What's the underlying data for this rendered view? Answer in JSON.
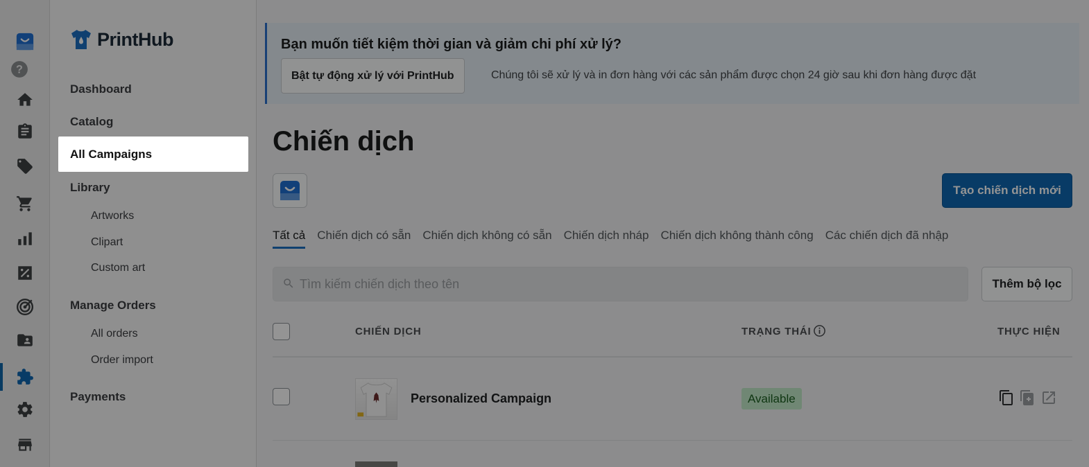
{
  "brand": {
    "name": "PrintHub"
  },
  "rail": {
    "icons": [
      "store-logo-icon",
      "help-icon",
      "home-icon",
      "orders-icon",
      "tags-icon",
      "cart-icon",
      "analytics-icon",
      "discounts-icon",
      "marketing-icon",
      "files-icon",
      "apps-icon",
      "settings-icon",
      "online-store-icon"
    ],
    "active": "apps-icon"
  },
  "nav": {
    "dashboard": "Dashboard",
    "catalog": "Catalog",
    "all_campaigns": "All Campaigns",
    "library": "Library",
    "artworks": "Artworks",
    "clipart": "Clipart",
    "custom_art": "Custom art",
    "manage_orders": "Manage Orders",
    "all_orders": "All orders",
    "order_import": "Order import",
    "payments": "Payments"
  },
  "banner": {
    "title": "Bạn muốn tiết kiệm thời gian và giảm chi phí xử lý?",
    "button": "Bật tự động xử lý với PrintHub",
    "desc": "Chúng tôi sẽ xử lý và in đơn hàng với các sản phẩm được chọn 24 giờ sau khi đơn hàng được đặt"
  },
  "page": {
    "title": "Chiến dịch",
    "create_button": "Tạo chiến dịch mới"
  },
  "tabs": [
    {
      "label": "Tất cả"
    },
    {
      "label": "Chiến dịch có sẵn"
    },
    {
      "label": "Chiến dịch không có sẵn"
    },
    {
      "label": "Chiến dịch nháp"
    },
    {
      "label": "Chiến dịch không thành công"
    },
    {
      "label": "Các chiến dịch đã nhập"
    }
  ],
  "search": {
    "placeholder": "Tìm kiếm chiến dịch theo tên"
  },
  "filter_button": "Thêm bộ lọc",
  "table": {
    "headers": {
      "campaign": "CHIẾN DỊCH",
      "status": "TRẠNG THÁI",
      "actions": "THỰC HIỆN"
    },
    "rows": [
      {
        "name": "Personalized Campaign",
        "status": "Available"
      }
    ]
  },
  "colors": {
    "accent": "#0e67b0",
    "badge_bg": "#c1e9c8",
    "banner_bg": "#e4ecf3"
  }
}
